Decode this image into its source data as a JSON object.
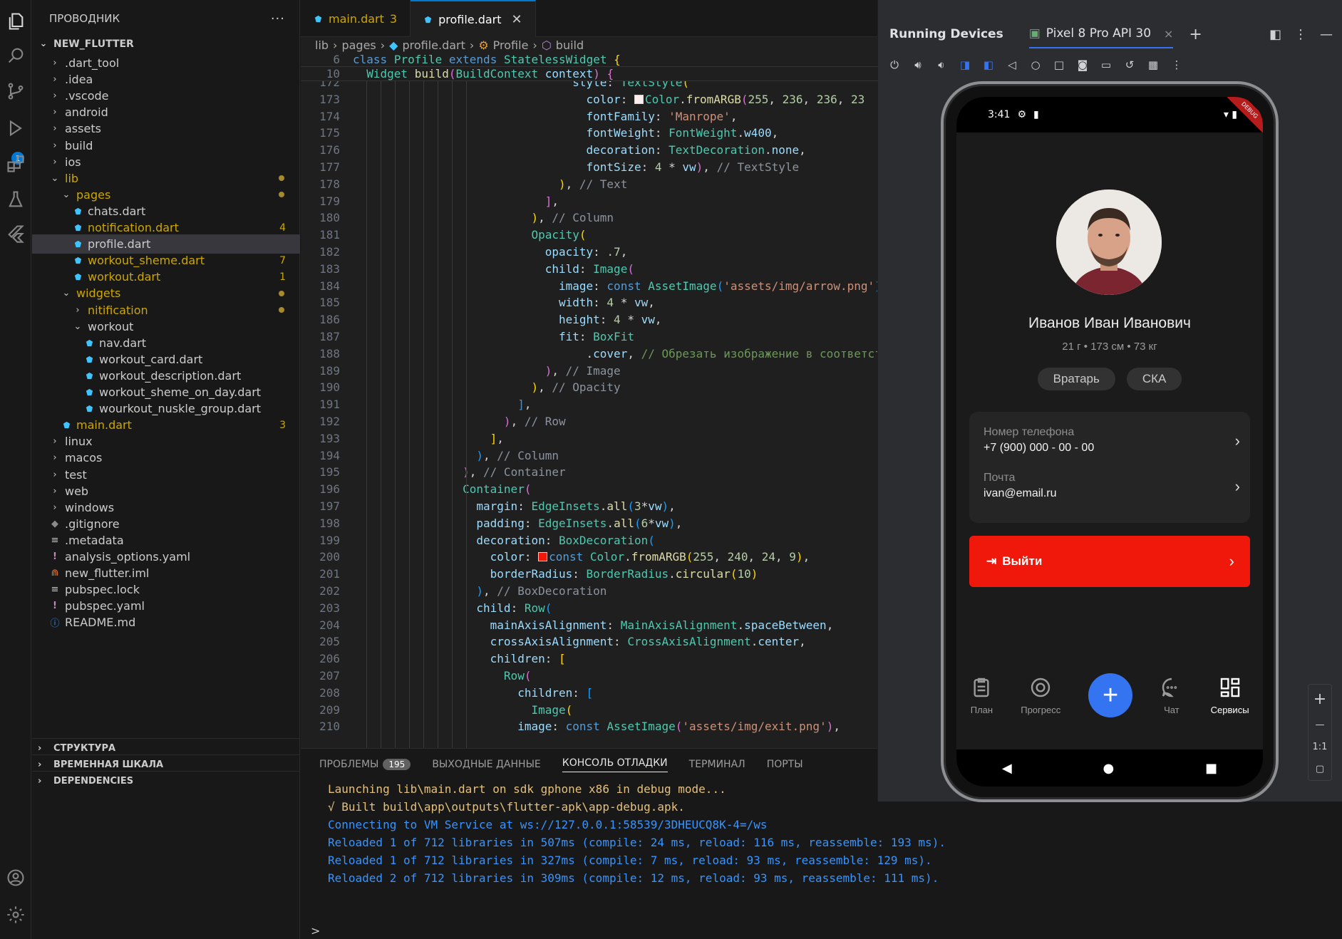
{
  "explorer": {
    "title": "ПРОВОДНИК",
    "more": "···",
    "project": "NEW_FLUTTER",
    "items": [
      {
        "label": ".dart_tool",
        "type": "folder",
        "depth": 1,
        "open": false
      },
      {
        "label": ".idea",
        "type": "folder",
        "depth": 1,
        "open": false
      },
      {
        "label": ".vscode",
        "type": "folder",
        "depth": 1,
        "open": false
      },
      {
        "label": "android",
        "type": "folder",
        "depth": 1,
        "open": false
      },
      {
        "label": "assets",
        "type": "folder",
        "depth": 1,
        "open": false
      },
      {
        "label": "build",
        "type": "folder",
        "depth": 1,
        "open": false
      },
      {
        "label": "ios",
        "type": "folder",
        "depth": 1,
        "open": false
      },
      {
        "label": "lib",
        "type": "folder",
        "depth": 1,
        "open": true,
        "modified": true,
        "dot": true
      },
      {
        "label": "pages",
        "type": "folder",
        "depth": 2,
        "open": true,
        "modified": true,
        "dot": true
      },
      {
        "label": "chats.dart",
        "type": "dart",
        "depth": 3
      },
      {
        "label": "notification.dart",
        "type": "dart",
        "depth": 3,
        "modified": true,
        "badge": "4"
      },
      {
        "label": "profile.dart",
        "type": "dart",
        "depth": 3,
        "selected": true
      },
      {
        "label": "workout_sheme.dart",
        "type": "dart",
        "depth": 3,
        "modified": true,
        "badge": "7"
      },
      {
        "label": "workout.dart",
        "type": "dart",
        "depth": 3,
        "modified": true,
        "badge": "1"
      },
      {
        "label": "widgets",
        "type": "folder",
        "depth": 2,
        "open": true,
        "modified": true,
        "dot": true
      },
      {
        "label": "nitification",
        "type": "folder",
        "depth": 3,
        "open": false,
        "modified": true,
        "dot": true
      },
      {
        "label": "workout",
        "type": "folder",
        "depth": 3,
        "open": true
      },
      {
        "label": "nav.dart",
        "type": "dart",
        "depth": 4
      },
      {
        "label": "workout_card.dart",
        "type": "dart",
        "depth": 4
      },
      {
        "label": "workout_description.dart",
        "type": "dart",
        "depth": 4
      },
      {
        "label": "workout_sheme_on_day.dart",
        "type": "dart",
        "depth": 4
      },
      {
        "label": "wourkout_nuskle_group.dart",
        "type": "dart",
        "depth": 4
      },
      {
        "label": "main.dart",
        "type": "dart",
        "depth": 2,
        "modified": true,
        "badge": "3"
      },
      {
        "label": "linux",
        "type": "folder",
        "depth": 1,
        "open": false
      },
      {
        "label": "macos",
        "type": "folder",
        "depth": 1,
        "open": false
      },
      {
        "label": "test",
        "type": "folder",
        "depth": 1,
        "open": false
      },
      {
        "label": "web",
        "type": "folder",
        "depth": 1,
        "open": false
      },
      {
        "label": "windows",
        "type": "folder",
        "depth": 1,
        "open": false
      },
      {
        "label": ".gitignore",
        "type": "git",
        "depth": 1
      },
      {
        "label": ".metadata",
        "type": "lines",
        "depth": 1
      },
      {
        "label": "analysis_options.yaml",
        "type": "yaml",
        "depth": 1
      },
      {
        "label": "new_flutter.iml",
        "type": "rss",
        "depth": 1
      },
      {
        "label": "pubspec.lock",
        "type": "lines",
        "depth": 1
      },
      {
        "label": "pubspec.yaml",
        "type": "yaml",
        "depth": 1
      },
      {
        "label": "README.md",
        "type": "info",
        "depth": 1
      }
    ],
    "sections": [
      "СТРУКТУРА",
      "ВРЕМЕННАЯ ШКАЛА",
      "DEPENDENCIES"
    ]
  },
  "tabs": [
    {
      "label": "main.dart",
      "badge": "3",
      "active": false
    },
    {
      "label": "profile.dart",
      "close": "✕",
      "active": true
    }
  ],
  "breadcrumb": [
    "lib",
    "pages",
    "profile.dart",
    "Profile",
    "build"
  ],
  "code": {
    "sticky": [
      {
        "ln": "6",
        "html": "<span class=\"k\">class</span> <span class=\"t\">Profile</span> <span class=\"k\">extends</span> <span class=\"t\">StatelessWidget</span> <span class=\"br1\">{</span>"
      },
      {
        "ln": "10",
        "html": "  <span class=\"t\">Widget</span> <span class=\"f\">build</span><span class=\"br2\">(</span><span class=\"t\">BuildContext</span> <span class=\"p\">context</span><span class=\"br2\">)</span> <span class=\"br2\">{</span>"
      }
    ],
    "lines": [
      {
        "ln": "172",
        "html": "                                <span class=\"p\">style</span>: <span class=\"t\">TextStyle</span><span class=\"br1\">(</span>"
      },
      {
        "ln": "173",
        "html": "                                  <span class=\"p\">color</span>: <span class=\"swatch\" style=\"background:#ffecec\"></span><span class=\"t\">Color</span>.<span class=\"f\">fromARGB</span><span class=\"br2\">(</span><span class=\"n\">255</span>, <span class=\"n\">236</span>, <span class=\"n\">236</span>, <span class=\"n\">23</span>"
      },
      {
        "ln": "174",
        "html": "                                  <span class=\"p\">fontFamily</span>: <span class=\"s\">'Manrope'</span>,"
      },
      {
        "ln": "175",
        "html": "                                  <span class=\"p\">fontWeight</span>: <span class=\"t\">FontWeight</span>.<span class=\"p\">w400</span>,"
      },
      {
        "ln": "176",
        "html": "                                  <span class=\"p\">decoration</span>: <span class=\"t\">TextDecoration</span>.<span class=\"p\">none</span>,"
      },
      {
        "ln": "177",
        "html": "                                  <span class=\"p\">fontSize</span>: <span class=\"n\">4</span> * <span class=\"p\">vw</span><span class=\"br2\">)</span>, <span class=\"cm\">// TextStyle</span>"
      },
      {
        "ln": "178",
        "html": "                              <span class=\"br1\">)</span>, <span class=\"cm\">// Text</span>"
      },
      {
        "ln": "179",
        "html": "                            <span class=\"br2\">]</span>,"
      },
      {
        "ln": "180",
        "html": "                          <span class=\"br1\">)</span>, <span class=\"cm\">// Column</span>"
      },
      {
        "ln": "181",
        "html": "                          <span class=\"t\">Opacity</span><span class=\"br1\">(</span>"
      },
      {
        "ln": "182",
        "html": "                            <span class=\"p\">opacity</span>: <span class=\"n\">.7</span>,"
      },
      {
        "ln": "183",
        "html": "                            <span class=\"p\">child</span>: <span class=\"t\">Image</span><span class=\"br2\">(</span>"
      },
      {
        "ln": "184",
        "html": "                              <span class=\"p\">image</span>: <span class=\"k\">const</span> <span class=\"t\">AssetImage</span><span class=\"br3\">(</span><span class=\"s\">'assets/img/arrow.png'</span><span class=\"br3\">)</span>"
      },
      {
        "ln": "185",
        "html": "                              <span class=\"p\">width</span>: <span class=\"n\">4</span> * <span class=\"p\">vw</span>,"
      },
      {
        "ln": "186",
        "html": "                              <span class=\"p\">height</span>: <span class=\"n\">4</span> * <span class=\"p\">vw</span>,"
      },
      {
        "ln": "187",
        "html": "                              <span class=\"p\">fit</span>: <span class=\"t\">BoxFit</span>"
      },
      {
        "ln": "188",
        "html": "                                  .<span class=\"p\">cover</span>, <span class=\"c\">// Обрезать изображение в соответст</span>"
      },
      {
        "ln": "189",
        "html": "                            <span class=\"br2\">)</span>, <span class=\"cm\">// Image</span>"
      },
      {
        "ln": "190",
        "html": "                          <span class=\"br1\">)</span>, <span class=\"cm\">// Opacity</span>"
      },
      {
        "ln": "191",
        "html": "                        <span class=\"br3\">]</span>,"
      },
      {
        "ln": "192",
        "html": "                      <span class=\"br2\">)</span>, <span class=\"cm\">// Row</span>"
      },
      {
        "ln": "193",
        "html": "                    <span class=\"br1\">]</span>,"
      },
      {
        "ln": "194",
        "html": "                  <span class=\"br3\">)</span>, <span class=\"cm\">// Column</span>"
      },
      {
        "ln": "195",
        "html": "                <span class=\"br2\">)</span>, <span class=\"cm\">// Container</span>"
      },
      {
        "ln": "196",
        "html": "                <span class=\"t\">Container</span><span class=\"br2\">(</span>"
      },
      {
        "ln": "197",
        "html": "                  <span class=\"p\">margin</span>: <span class=\"t\">EdgeInsets</span>.<span class=\"f\">all</span><span class=\"br3\">(</span><span class=\"n\">3</span>*<span class=\"p\">vw</span><span class=\"br3\">)</span>,"
      },
      {
        "ln": "198",
        "html": "                  <span class=\"p\">padding</span>: <span class=\"t\">EdgeInsets</span>.<span class=\"f\">all</span><span class=\"br3\">(</span><span class=\"n\">6</span>*<span class=\"p\">vw</span><span class=\"br3\">)</span>,"
      },
      {
        "ln": "199",
        "html": "                  <span class=\"p\">decoration</span>: <span class=\"t\">BoxDecoration</span><span class=\"br3\">(</span>"
      },
      {
        "ln": "200",
        "html": "                    <span class=\"p\">color</span>: <span class=\"swatch\" style=\"background:#f01809\"></span><span class=\"k\">const</span> <span class=\"t\">Color</span>.<span class=\"f\">fromARGB</span><span class=\"br1\">(</span><span class=\"n\">255</span>, <span class=\"n\">240</span>, <span class=\"n\">24</span>, <span class=\"n\">9</span><span class=\"br1\">)</span>,"
      },
      {
        "ln": "201",
        "html": "                    <span class=\"p\">borderRadius</span>: <span class=\"t\">BorderRadius</span>.<span class=\"f\">circular</span><span class=\"br1\">(</span><span class=\"n\">10</span><span class=\"br1\">)</span>"
      },
      {
        "ln": "202",
        "html": "                  <span class=\"br3\">)</span>, <span class=\"cm\">// BoxDecoration</span>"
      },
      {
        "ln": "203",
        "html": "                  <span class=\"p\">child</span>: <span class=\"t\">Row</span><span class=\"br3\">(</span>"
      },
      {
        "ln": "204",
        "html": "                    <span class=\"p\">mainAxisAlignment</span>: <span class=\"t\">MainAxisAlignment</span>.<span class=\"p\">spaceBetween</span>,"
      },
      {
        "ln": "205",
        "html": "                    <span class=\"p\">crossAxisAlignment</span>: <span class=\"t\">CrossAxisAlignment</span>.<span class=\"p\">center</span>,"
      },
      {
        "ln": "206",
        "html": "                    <span class=\"p\">children</span>: <span class=\"br1\">[</span>"
      },
      {
        "ln": "207",
        "html": "                      <span class=\"t\">Row</span><span class=\"br2\">(</span>"
      },
      {
        "ln": "208",
        "html": "                        <span class=\"p\">children</span>: <span class=\"br3\">[</span>"
      },
      {
        "ln": "209",
        "html": "                          <span class=\"t\">Image</span><span class=\"br1\">(</span>"
      },
      {
        "ln": "210",
        "html": "                        <span class=\"p\">image</span>: <span class=\"k\">const</span> <span class=\"t\">AssetImage</span><span class=\"br2\">(</span><span class=\"s\">'assets/img/exit.png'</span><span class=\"br2\">)</span>,"
      }
    ]
  },
  "panel": {
    "tabs": [
      {
        "label": "ПРОБЛЕМЫ",
        "count": "195"
      },
      {
        "label": "ВЫХОДНЫЕ ДАННЫЕ"
      },
      {
        "label": "КОНСОЛЬ ОТЛАДКИ",
        "active": true
      },
      {
        "label": "ТЕРМИНАЛ"
      },
      {
        "label": "ПОРТЫ"
      }
    ],
    "console": [
      {
        "text": "Launching lib\\main.dart on sdk gphone x86 in debug mode...",
        "color": "yellow"
      },
      {
        "text": "√  Built build\\app\\outputs\\flutter-apk\\app-debug.apk.",
        "color": "yellow"
      },
      {
        "text": "Connecting to VM Service at ws://127.0.0.1:58539/3DHEUCQ8K-4=/ws",
        "color": "blue"
      },
      {
        "text": "Reloaded 1 of 712 libraries in 507ms (compile: 24 ms, reload: 116 ms, reassemble: 193 ms).",
        "color": "blue"
      },
      {
        "text": "Reloaded 1 of 712 libraries in 327ms (compile: 7 ms, reload: 93 ms, reassemble: 129 ms).",
        "color": "blue"
      },
      {
        "text": "Reloaded 2 of 712 libraries in 309ms (compile: 12 ms, reload: 93 ms, reassemble: 111 ms).",
        "color": "blue"
      }
    ],
    "prompt": ">"
  },
  "devices": {
    "title": "Running Devices",
    "device_tab": "Pixel 8 Pro API 30",
    "close": "×",
    "add": "+",
    "zoom_in": "+",
    "zoom_out": "—",
    "zoom_actual": "1:1"
  },
  "phone": {
    "time": "3:41",
    "debug_banner": "DEBUG",
    "name": "Иванов Иван Иванович",
    "meta": "21 г • 173 см • 73 кг",
    "chips": [
      "Вратарь",
      "СКА"
    ],
    "phone_label": "Номер телефона",
    "phone_value": "+7 (900) 000 - 00 - 00",
    "email_label": "Почта",
    "email_value": "ivan@email.ru",
    "logout": "Выйти",
    "nav": [
      "План",
      "Прогресс",
      "Чат",
      "Сервисы"
    ],
    "fab": "+"
  },
  "colors": {
    "accent": "#0078d4",
    "logout_red": "#f0180a",
    "fab_blue": "#3574f0",
    "modified_yellow": "#cca700"
  }
}
